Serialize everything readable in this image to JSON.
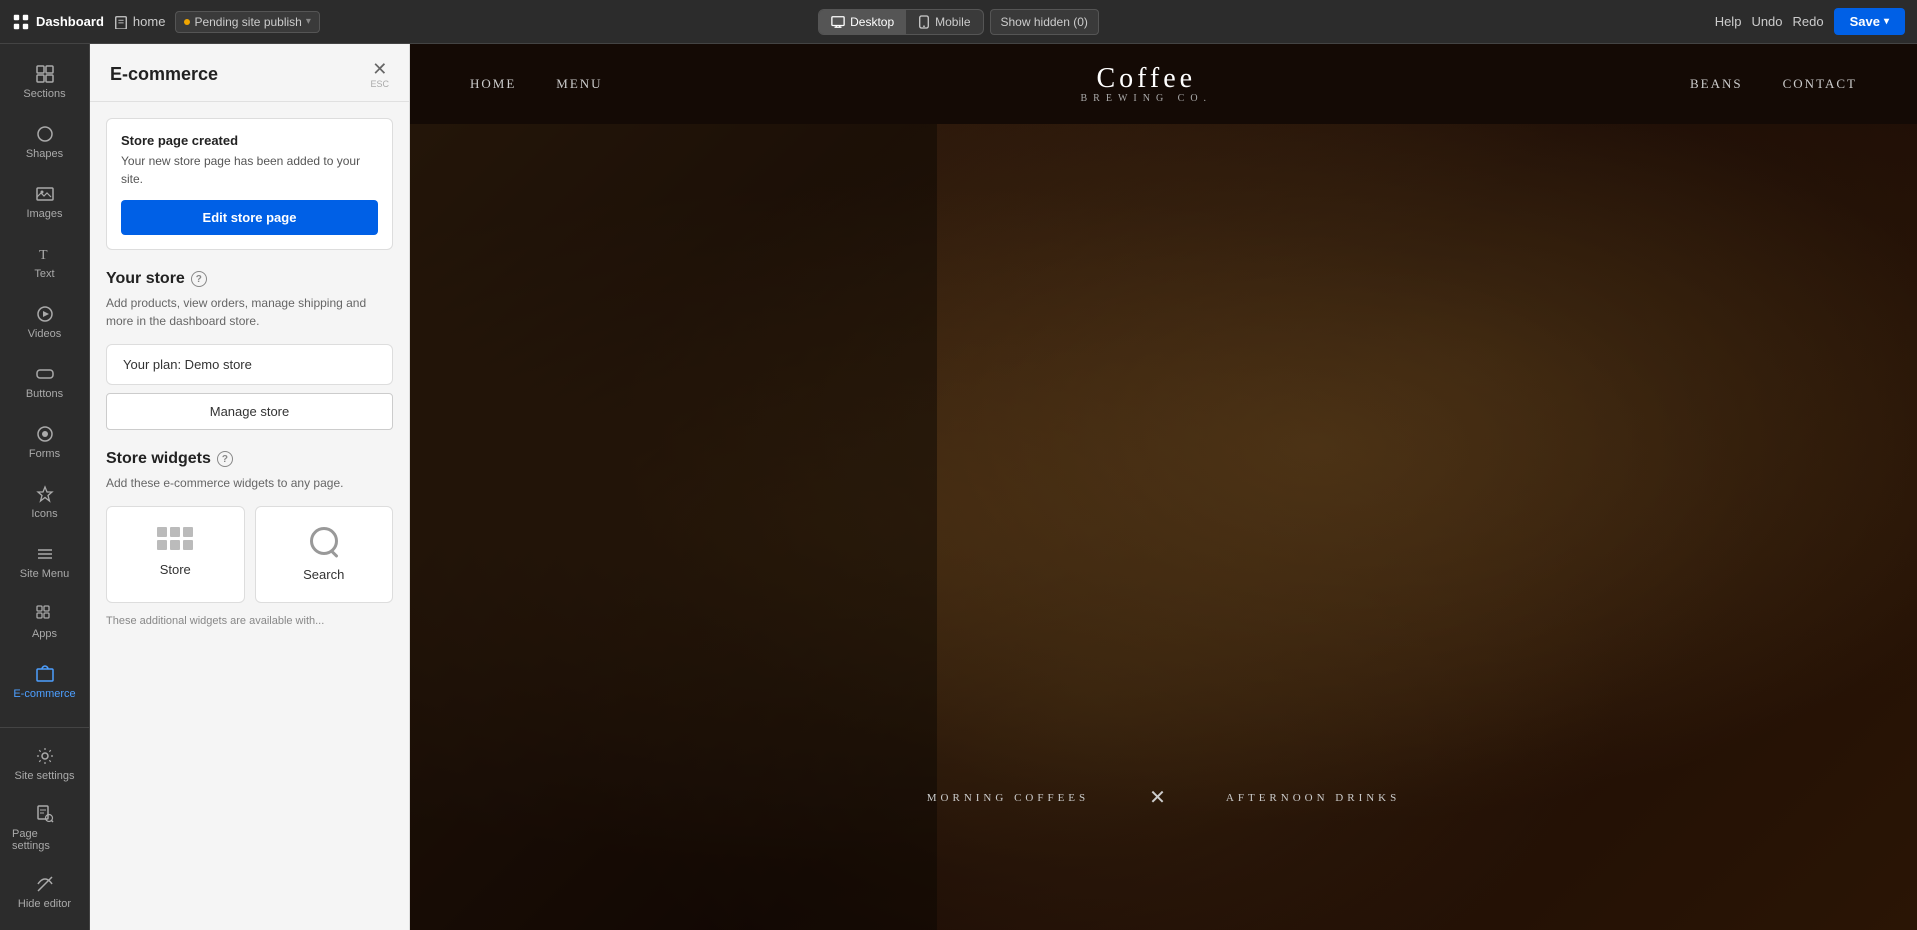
{
  "topbar": {
    "logo_label": "Dashboard",
    "page_label": "home",
    "pending_label": "Pending site publish",
    "device_desktop": "Desktop",
    "device_mobile": "Mobile",
    "show_hidden": "Show hidden (0)",
    "help": "Help",
    "undo": "Undo",
    "redo": "Redo",
    "save": "Save",
    "active_device": "desktop"
  },
  "sidebar": {
    "items": [
      {
        "id": "sections",
        "label": "Sections",
        "icon": "grid-icon"
      },
      {
        "id": "shapes",
        "label": "Shapes",
        "icon": "shapes-icon"
      },
      {
        "id": "images",
        "label": "Images",
        "icon": "images-icon"
      },
      {
        "id": "text",
        "label": "Text",
        "icon": "text-icon"
      },
      {
        "id": "videos",
        "label": "Videos",
        "icon": "videos-icon"
      },
      {
        "id": "buttons",
        "label": "Buttons",
        "icon": "buttons-icon"
      },
      {
        "id": "forms",
        "label": "Forms",
        "icon": "forms-icon"
      },
      {
        "id": "icons",
        "label": "Icons",
        "icon": "icons-icon"
      },
      {
        "id": "site-menu",
        "label": "Site Menu",
        "icon": "menu-icon"
      },
      {
        "id": "apps",
        "label": "Apps",
        "icon": "apps-icon"
      },
      {
        "id": "ecommerce",
        "label": "E-commerce",
        "icon": "ecommerce-icon"
      }
    ],
    "bottom_items": [
      {
        "id": "site-settings",
        "label": "Site settings",
        "icon": "site-settings-icon"
      },
      {
        "id": "page-settings",
        "label": "Page settings",
        "icon": "page-settings-icon"
      },
      {
        "id": "hide-editor",
        "label": "Hide editor",
        "icon": "hide-icon"
      }
    ]
  },
  "panel": {
    "title": "E-commerce",
    "close_label": "✕",
    "esc_label": "ESC",
    "notice": {
      "title": "Store page created",
      "text": "Your new store page has been added to your site.",
      "button": "Edit store page"
    },
    "your_store": {
      "title": "Your store",
      "desc": "Add products, view orders, manage shipping and more in the dashboard store.",
      "plan_label": "Your plan: Demo store",
      "manage_btn": "Manage store"
    },
    "store_widgets": {
      "title": "Store widgets",
      "desc": "Add these e-commerce widgets to any page.",
      "widgets": [
        {
          "id": "store",
          "label": "Store"
        },
        {
          "id": "search",
          "label": "Search"
        }
      ],
      "footer_text": "These additional widgets are available with..."
    }
  },
  "site_preview": {
    "nav_links_left": [
      "HOME",
      "MENU"
    ],
    "logo_main": "Coffee",
    "logo_sub": "BREWING CO.",
    "nav_links_right": [
      "BEANS",
      "CONTACT"
    ],
    "tab_left": "MORNING COFFEES",
    "tab_separator": "✕",
    "tab_right": "AFTERNOON DRINKS"
  }
}
